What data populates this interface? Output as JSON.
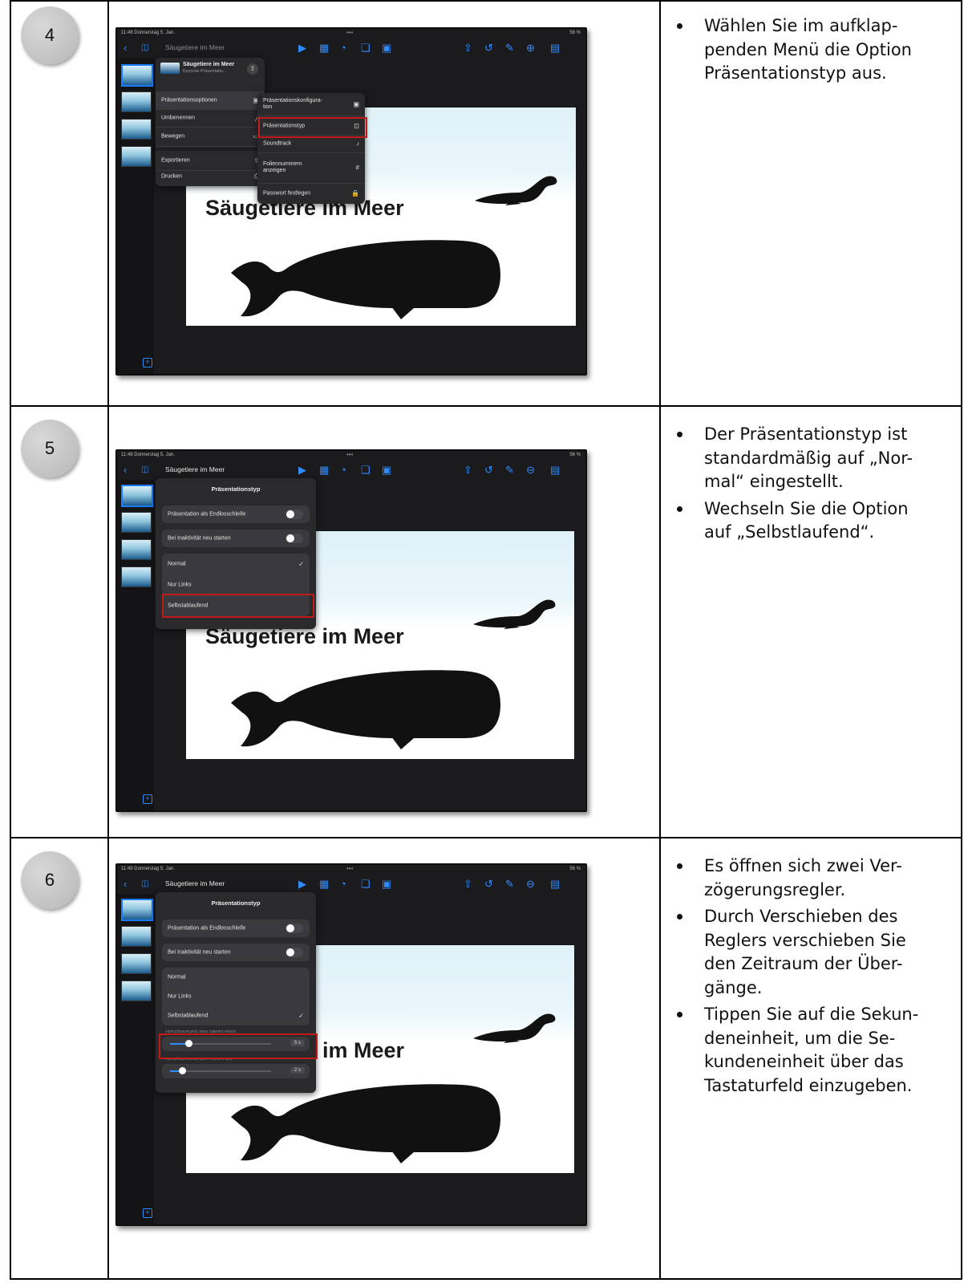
{
  "steps": [
    {
      "number": "4",
      "bullets": [
        [
          "Wählen Sie im aufklap-",
          "penden Menü die Option",
          "Präsentationstyp aus."
        ]
      ],
      "screen": {
        "status_time": "11:48  Donnerstag 5. Jan.",
        "battery": "56 %",
        "doc_title": "Säugetiere im Meer",
        "doc_header_title": "Säugetiere im Meer",
        "doc_header_subtitle": "Keynote-Präsentatio...",
        "menu_left": [
          "Präsentationsoptionen",
          "Umbenennen",
          "Bewegen",
          "Exportieren",
          "Drucken"
        ],
        "menu_right": [
          "Präsentationskonfigura-\ntion",
          "Präsentationstyp",
          "Soundtrack",
          "Foliennummern\nanzeigen",
          "Passwort festlegen"
        ],
        "slide_title": "Säugetiere im Meer"
      }
    },
    {
      "number": "5",
      "bullets": [
        [
          "Der Präsentationstyp ist",
          "standardmäßig auf „Nor-",
          "mal“ eingestellt."
        ],
        [
          "Wechseln Sie die Option",
          "auf „Selbstlaufend“."
        ]
      ],
      "screen": {
        "status_time": "11:48  Donnerstag 5. Jan.",
        "battery": "56 %",
        "doc_title": "Säugetiere im Meer",
        "popover_title": "Präsentationstyp",
        "toggle1": "Präsentation als Endlosschleife",
        "toggle2": "Bei Inaktivität neu starten",
        "types": [
          "Normal",
          "Nur Links",
          "Selbstablaufend"
        ],
        "slide_title": "Säugetiere im Meer"
      }
    },
    {
      "number": "6",
      "bullets": [
        [
          "Es öffnen sich zwei Ver-",
          "zögerungsregler."
        ],
        [
          "Durch Verschieben des",
          "Reglers verschieben Sie",
          "den Zeitraum der Über-",
          "gänge."
        ],
        [
          "Tippen Sie auf die Sekun-",
          "deneinheit, um die Se-",
          "kundeneinheit über das",
          "Tastaturfeld einzugeben."
        ]
      ],
      "screen": {
        "status_time": "11:49  Donnerstag 5. Jan.",
        "battery": "56 %",
        "doc_title": "Säugetiere im Meer",
        "popover_title": "Präsentationstyp",
        "toggle1": "Präsentation als Endlosschleife",
        "toggle2": "Bei Inaktivität neu starten",
        "types": [
          "Normal",
          "Nur Links",
          "Selbstablaufend"
        ],
        "cap1": "VERZÖGERUNG DES ÜBERGANGS",
        "val1": "5 s",
        "level1": 0.18,
        "cap2": "VERZÖGERUNG DER ANIMATION",
        "val2": "2 s",
        "level2": 0.12,
        "slide_title": "im Meer"
      }
    }
  ]
}
